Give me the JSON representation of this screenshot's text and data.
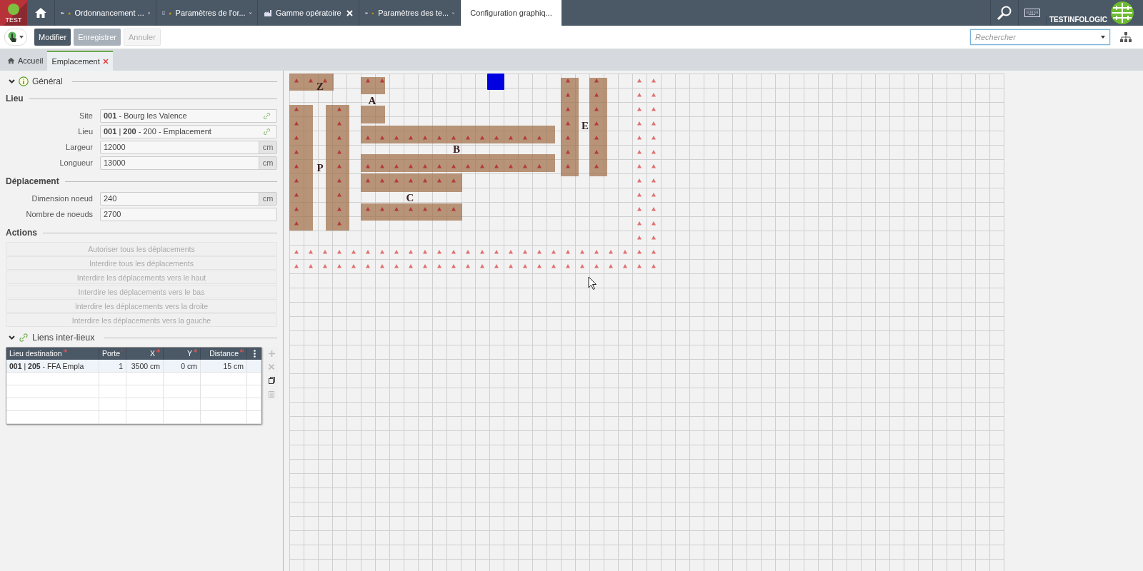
{
  "app": {
    "badge": "TEST",
    "company": "TESTINFOLOGIC"
  },
  "tabs": [
    {
      "label": "Ordonnancement ...",
      "kind": "forklift",
      "warning": true,
      "selected": false
    },
    {
      "label": "Paramètres de l'or...",
      "kind": "chart",
      "warning": true,
      "selected": false
    },
    {
      "label": "Gamme opératoire",
      "kind": "factory",
      "warning": false,
      "selected": false
    },
    {
      "label": "Paramètres des te...",
      "kind": "forklift",
      "warning": true,
      "selected": false
    },
    {
      "label": "Configuration graphiq...",
      "kind": "monitor",
      "warning": false,
      "selected": true
    }
  ],
  "toolbar": {
    "buttons": [
      {
        "label": "Modifier",
        "kind": "primary"
      },
      {
        "label": "Enregistrer",
        "kind": "secondary"
      },
      {
        "label": "Annuler",
        "kind": "disabled"
      }
    ],
    "search": {
      "placeholder": "Rechercher"
    }
  },
  "breadcrumbs": [
    {
      "label": "Accueil",
      "selected": false,
      "closable": false
    },
    {
      "label": "Emplacement",
      "selected": true,
      "closable": true
    }
  ],
  "general": {
    "title": "Général",
    "expanded": true
  },
  "groups": [
    {
      "title": "Lieu",
      "fields": [
        {
          "label": "Site",
          "value": "**001** - Bourg les Valence",
          "kind": "link"
        },
        {
          "label": "Lieu",
          "value": "**001** | **200** - 200 - Emplacement",
          "kind": "link"
        },
        {
          "label": "Largeur",
          "value": "12000",
          "kind": "unit",
          "unit": "cm"
        },
        {
          "label": "Longueur",
          "value": "13000",
          "kind": "unit",
          "unit": "cm"
        }
      ]
    },
    {
      "title": "Déplacement",
      "fields": [
        {
          "label": "Dimension noeud",
          "value": "240",
          "kind": "unit",
          "unit": "cm"
        },
        {
          "label": "Nombre de noeuds",
          "value": "2700",
          "kind": "plain"
        }
      ]
    }
  ],
  "actions": {
    "title": "Actions",
    "buttons": [
      {
        "label": "Autoriser tous les déplacements",
        "disabled": true
      },
      {
        "label": "Interdire tous les déplacements",
        "disabled": true
      },
      {
        "label": "Interdire les déplacements vers le haut",
        "disabled": true
      },
      {
        "label": "Interdire les déplacements vers le bas",
        "disabled": true
      },
      {
        "label": "Interdire les déplacements vers la droite",
        "disabled": true
      },
      {
        "label": "Interdire les déplacements vers la gauche",
        "disabled": true
      }
    ]
  },
  "links": {
    "title": "Liens inter-lieux",
    "expanded": true,
    "columns": [
      {
        "label": "Lieu destination",
        "required": true
      },
      {
        "label": "Porte",
        "required": true
      },
      {
        "label": "X",
        "required": true
      },
      {
        "label": "Y",
        "required": true
      },
      {
        "label": "Distance",
        "required": true
      }
    ],
    "rows": [
      {
        "cells": [
          "**001** | **205** - FFA Empla",
          "1",
          "3500 cm",
          "0 cm",
          "15 cm"
        ],
        "selected": true
      }
    ],
    "tools": [
      {
        "kind": "add",
        "disabled": true
      },
      {
        "kind": "delete",
        "disabled": true
      },
      {
        "kind": "copy",
        "disabled": false
      },
      {
        "kind": "paste",
        "disabled": true
      }
    ]
  },
  "map": {
    "zones": [
      {
        "label": "Z"
      },
      {
        "label": "A"
      },
      {
        "label": "E"
      },
      {
        "label": "B"
      },
      {
        "label": "P"
      },
      {
        "label": "C"
      }
    ]
  }
}
